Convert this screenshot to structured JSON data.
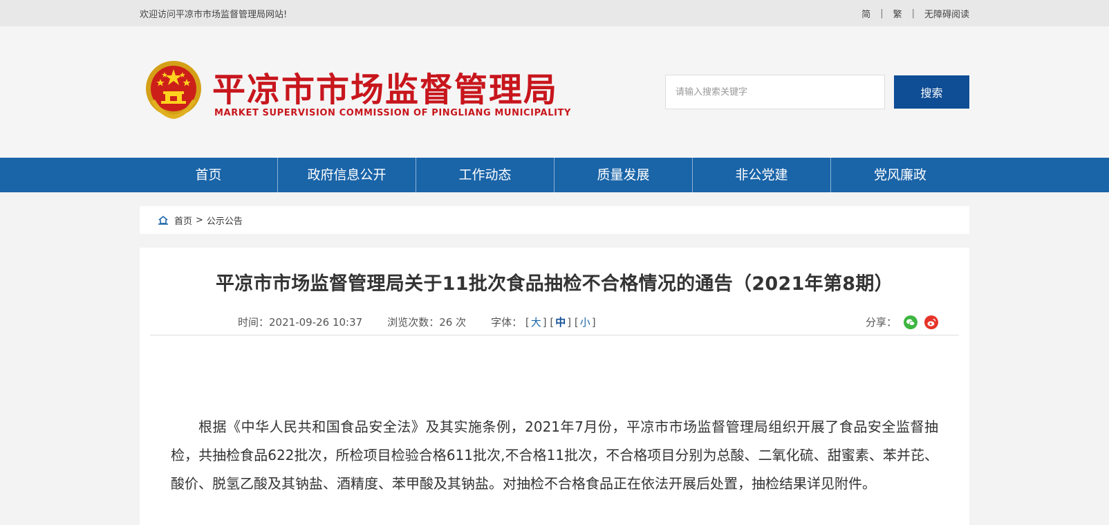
{
  "topbar": {
    "welcome": "欢迎访问平凉市市场监督管理局网站!",
    "simplified": "简",
    "traditional": "繁",
    "accessibility": "无障碍阅读",
    "sep": "|"
  },
  "header": {
    "title_cn": "平凉市市场监督管理局",
    "title_en": "MARKET SUPERVISION COMMISSION OF PINGLIANG MUNICIPALITY",
    "search_placeholder": "请输入搜索关键字",
    "search_button": "搜索",
    "emblem_icon": "national-emblem-icon"
  },
  "nav": [
    "首页",
    "政府信息公开",
    "工作动态",
    "质量发展",
    "非公党建",
    "党风廉政"
  ],
  "breadcrumb": {
    "home": "首页",
    "sep": ">",
    "current": "公示公告"
  },
  "article": {
    "title": "平凉市市场监督管理局关于11批次食品抽检不合格情况的通告（2021年第8期）",
    "time_label": "时间：",
    "time_value": "2021-09-26 10:37",
    "views_label": "浏览次数：",
    "views_value": "26",
    "views_unit": "次",
    "font_label": "字体：",
    "font_large": "大",
    "font_medium": "中",
    "font_small": "小",
    "share_label": "分享：",
    "body": "根据《中华人民共和国食品安全法》及其实施条例，2021年7月份，平凉市市场监督管理局组织开展了食品安全监督抽检，共抽检食品622批次，所检项目检验合格611批次,不合格11批次，不合格项目分别为总酸、二氧化硫、甜蜜素、苯并芘、酸价、脱氢乙酸及其钠盐、酒精度、苯甲酸及其钠盐。对抽检不合格食品正在依法开展后处置，抽检结果详见附件。"
  },
  "colors": {
    "brand_red": "#c8161d",
    "nav_blue": "#1a64a8",
    "button_blue": "#0f4d95"
  }
}
